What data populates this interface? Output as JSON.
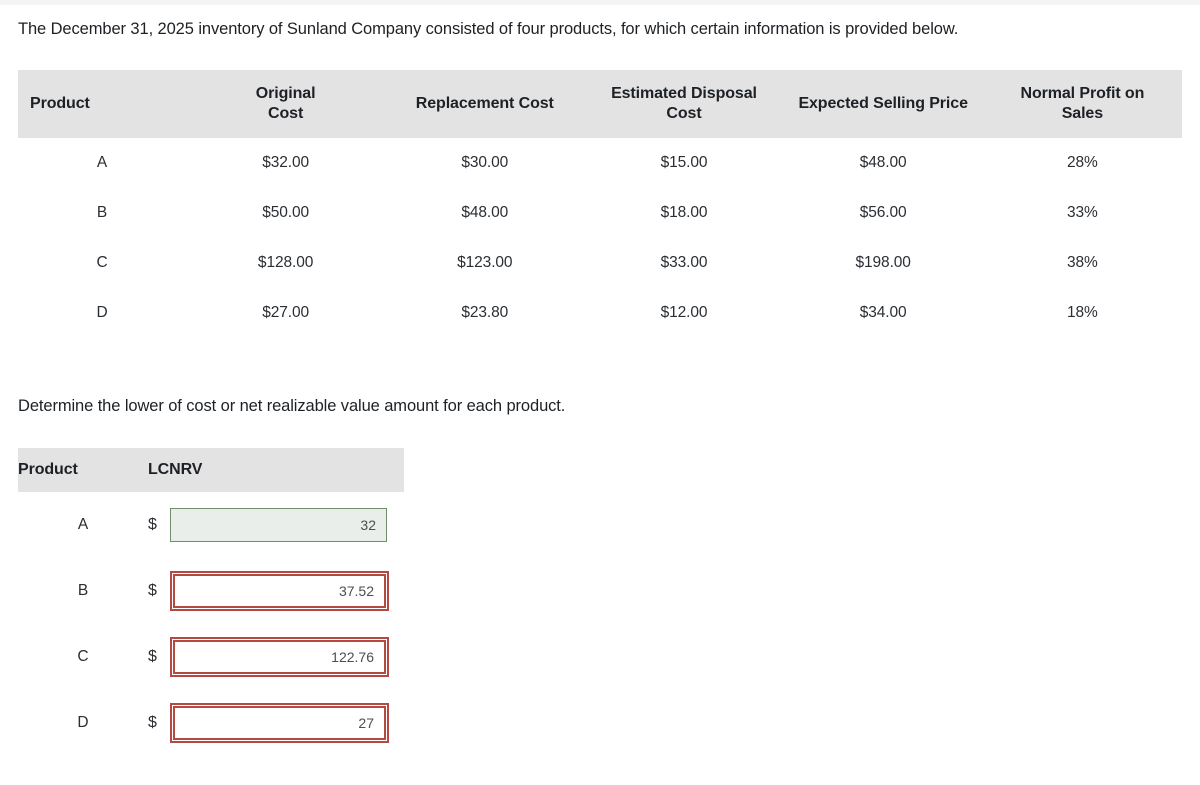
{
  "intro": {
    "text": "The December 31, 2025 inventory of Sunland Company consisted of four products, for which certain information is provided below."
  },
  "instruction": {
    "text": "Determine the lower of cost or net realizable value amount for each product."
  },
  "data_table": {
    "headers": {
      "product": "Product",
      "original_cost": "Original Cost",
      "replacement_cost": "Replacement Cost",
      "disposal_cost": "Estimated Disposal Cost",
      "selling_price": "Expected Selling Price",
      "normal_profit": "Normal Profit on Sales"
    },
    "header_lines": {
      "original_cost_1": "Original",
      "original_cost_2": "Cost",
      "replacement_cost_1": "Replacement Cost",
      "disposal_cost_1": "Estimated Disposal",
      "disposal_cost_2": "Cost",
      "selling_price_1": "Expected Selling Price",
      "normal_profit_1": "Normal Profit on",
      "normal_profit_2": "Sales"
    },
    "rows": [
      {
        "product": "A",
        "original_cost": "$32.00",
        "replacement_cost": "$30.00",
        "disposal_cost": "$15.00",
        "selling_price": "$48.00",
        "normal_profit": "28%"
      },
      {
        "product": "B",
        "original_cost": "$50.00",
        "replacement_cost": "$48.00",
        "disposal_cost": "$18.00",
        "selling_price": "$56.00",
        "normal_profit": "33%"
      },
      {
        "product": "C",
        "original_cost": "$128.00",
        "replacement_cost": "$123.00",
        "disposal_cost": "$33.00",
        "selling_price": "$198.00",
        "normal_profit": "38%"
      },
      {
        "product": "D",
        "original_cost": "$27.00",
        "replacement_cost": "$23.80",
        "disposal_cost": "$12.00",
        "selling_price": "$34.00",
        "normal_profit": "18%"
      }
    ]
  },
  "answer_table": {
    "headers": {
      "product": "Product",
      "lcnrv": "LCNRV"
    },
    "currency_symbol": "$",
    "rows": [
      {
        "product": "A",
        "value": "32",
        "state": "correct"
      },
      {
        "product": "B",
        "value": "37.52",
        "state": "incorrect"
      },
      {
        "product": "C",
        "value": "122.76",
        "state": "incorrect"
      },
      {
        "product": "D",
        "value": "27",
        "state": "incorrect"
      }
    ]
  },
  "colors": {
    "header_background": "#e3e3e3",
    "correct_border": "#6f8f6c",
    "correct_fill": "#eaeeea",
    "incorrect_border": "#b44a42",
    "text": "#1d2125"
  }
}
